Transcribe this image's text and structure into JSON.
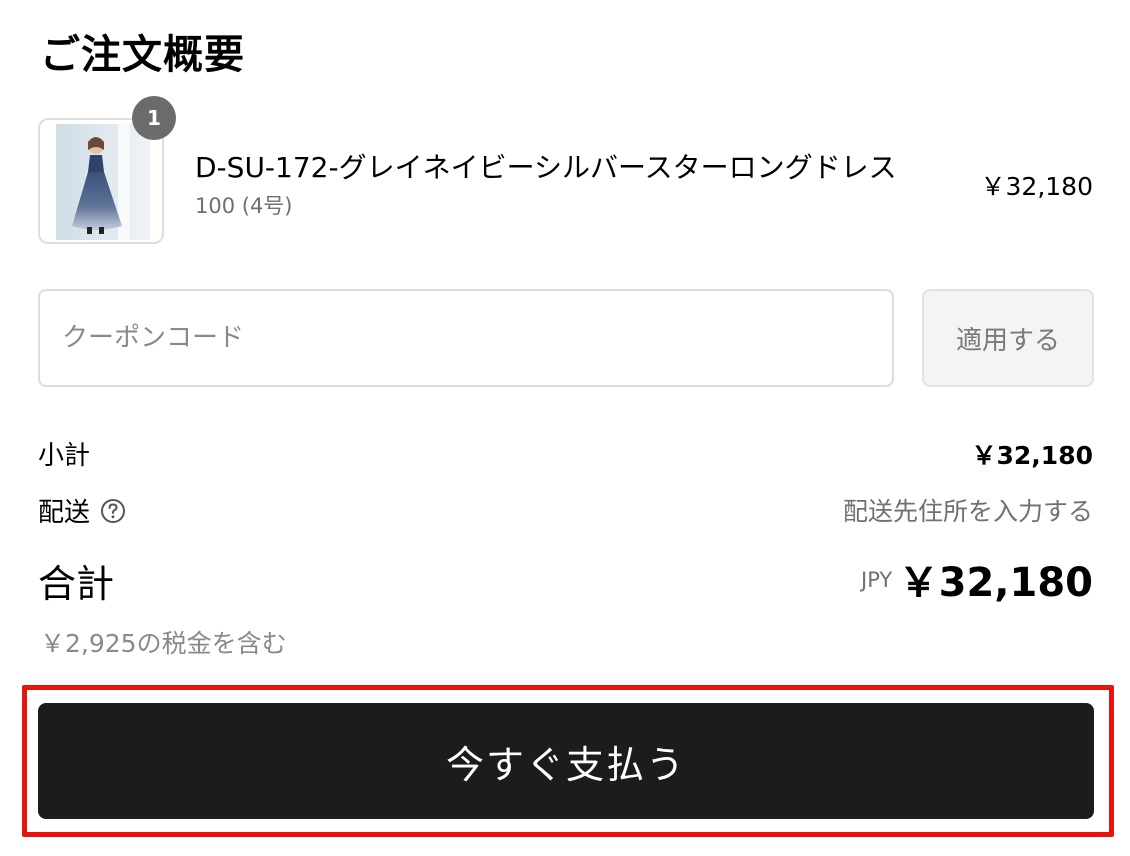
{
  "summary": {
    "title": "ご注文概要"
  },
  "item": {
    "quantity": "1",
    "name": "D-SU-172-グレイネイビーシルバースターロングドレス",
    "variant": "100 (4号)",
    "price": "￥32,180",
    "image": "product-thumbnail"
  },
  "coupon": {
    "placeholder": "クーポンコード",
    "value": "",
    "apply_label": "適用する"
  },
  "totals": {
    "subtotal_label": "小計",
    "subtotal_value": "￥32,180",
    "shipping_label": "配送",
    "shipping_value": "配送先住所を入力する",
    "total_label": "合計",
    "currency": "JPY",
    "total_value": "￥32,180",
    "tax_note": "￥2,925の税金を含む"
  },
  "pay": {
    "label": "今すぐ支払う"
  },
  "colors": {
    "pay_button": "#1c1c1c",
    "highlight": "#e8150f"
  },
  "icons": {
    "help": "question-circle-icon"
  }
}
